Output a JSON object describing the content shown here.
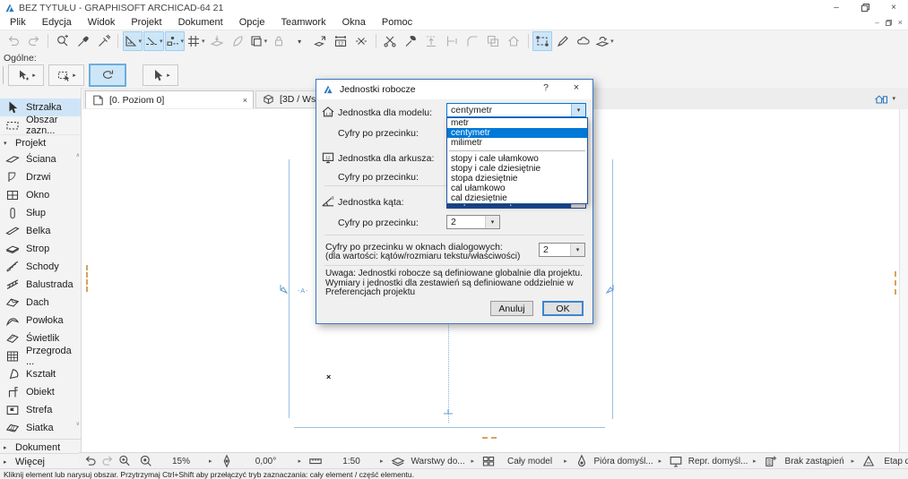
{
  "window": {
    "title": "BEZ TYTUŁU - GRAPHISOFT ARCHICAD-64 21",
    "controls": {
      "minimize": "–",
      "restore": "restore",
      "close": "×"
    }
  },
  "menu": {
    "items": [
      "Plik",
      "Edycja",
      "Widok",
      "Projekt",
      "Dokument",
      "Opcje",
      "Teamwork",
      "Okna",
      "Pomoc"
    ]
  },
  "toolbar": {
    "buttons": [
      {
        "icon": "undo",
        "state": "disabled"
      },
      {
        "icon": "redo",
        "state": "disabled"
      },
      {
        "sep": true
      },
      {
        "icon": "zoom-select"
      },
      {
        "icon": "eyedropper"
      },
      {
        "icon": "syringe"
      },
      {
        "sep": true
      },
      {
        "icon": "guide-setsquare",
        "state": "active",
        "dd": true
      },
      {
        "icon": "snap-guides",
        "state": "active",
        "dd": true
      },
      {
        "icon": "snap-points",
        "state": "active",
        "dd": true
      },
      {
        "icon": "grid-snap",
        "dd": true
      },
      {
        "icon": "gravity",
        "state": "disabled"
      },
      {
        "icon": "plane",
        "state": "disabled"
      },
      {
        "icon": "frame",
        "dd": true
      },
      {
        "icon": "lock",
        "state": "disabled"
      },
      {
        "icon": "chevron-down"
      },
      {
        "icon": "move"
      },
      {
        "icon": "dimension-12"
      },
      {
        "icon": "stretch"
      },
      {
        "sep": true
      },
      {
        "icon": "split"
      },
      {
        "icon": "adjust"
      },
      {
        "icon": "elevate",
        "state": "disabled"
      },
      {
        "icon": "trim",
        "state": "disabled"
      },
      {
        "icon": "fillet",
        "state": "disabled"
      },
      {
        "icon": "intersect",
        "state": "disabled"
      },
      {
        "icon": "home",
        "state": "disabled"
      },
      {
        "sep": true
      },
      {
        "icon": "marquee-transform",
        "state": "active"
      },
      {
        "icon": "edit-pencil"
      },
      {
        "icon": "revision-cloud"
      },
      {
        "icon": "visual-compare",
        "dd": true
      }
    ]
  },
  "general_palette": {
    "label": "Ogólne:",
    "buttons": [
      {
        "icon": "select-move",
        "fly": true
      },
      {
        "icon": "marquee-select",
        "fly": true
      },
      {
        "icon": "rotate-orbit",
        "state": "active"
      },
      {
        "icon": "arrow-tool",
        "fly": true,
        "gap": true
      }
    ]
  },
  "toolbox": {
    "items": [
      {
        "label": "Strzałka",
        "icon": "arrow-cursor",
        "selected": true
      },
      {
        "label": "Obszar zazn...",
        "icon": "marquee"
      },
      {
        "label": "Projekt",
        "group": true,
        "expanded": true
      },
      {
        "label": "Ściana",
        "icon": "wall"
      },
      {
        "label": "Drzwi",
        "icon": "door"
      },
      {
        "label": "Okno",
        "icon": "window"
      },
      {
        "label": "Słup",
        "icon": "column"
      },
      {
        "label": "Belka",
        "icon": "beam"
      },
      {
        "label": "Strop",
        "icon": "slab"
      },
      {
        "label": "Schody",
        "icon": "stairs"
      },
      {
        "label": "Balustrada",
        "icon": "railing"
      },
      {
        "label": "Dach",
        "icon": "roof"
      },
      {
        "label": "Powłoka",
        "icon": "shell"
      },
      {
        "label": "Świetlik",
        "icon": "skylight"
      },
      {
        "label": "Przegroda ...",
        "icon": "curtain-wall"
      },
      {
        "label": "Kształt",
        "icon": "morph"
      },
      {
        "label": "Obiekt",
        "icon": "object-chair"
      },
      {
        "label": "Strefa",
        "icon": "zone"
      },
      {
        "label": "Siatka",
        "icon": "mesh"
      },
      {
        "label": "Dokument",
        "group": true,
        "pinned": true
      },
      {
        "label": "Więcej",
        "group": true,
        "pinned": true
      }
    ]
  },
  "tabs": {
    "items": [
      {
        "label": "[0. Poziom 0]",
        "icon": "floorplan",
        "active": true,
        "close": "×"
      },
      {
        "label": "[3D / Wszystk",
        "icon": "cube",
        "active": false
      }
    ],
    "right_icon": "project-home"
  },
  "dialog": {
    "title": "Jednostki robocze",
    "help_label": "?",
    "close_label": "×",
    "fields": {
      "model": {
        "label": "Jednostka dla modelu:",
        "value": "centymetr"
      },
      "model_digits": {
        "label": "Cyfry po przecinku:"
      },
      "layout": {
        "label": "Jednostka dla arkusza:"
      },
      "layout_digits": {
        "label": "Cyfry po przecinku:"
      },
      "angle": {
        "label": "Jednostka kąta:",
        "value": "stopnie dziesiętnie"
      },
      "angle_digits": {
        "label": "Cyfry po przecinku:",
        "value": "2"
      }
    },
    "dropdown": {
      "metric_options": [
        "metr",
        "centymetr",
        "milimetr"
      ],
      "imperial_options": [
        "stopy i cale ułamkowo",
        "stopy i cale dziesiętnie",
        "stopa dziesiętnie",
        "cal ułamkowo",
        "cal dziesiętnie"
      ],
      "selected": "centymetr"
    },
    "dialog_digits": {
      "label": "Cyfry po przecinku w oknach dialogowych:",
      "sublabel": "(dla wartości: kątów/rozmiaru tekstu/właściwości)",
      "value": "2"
    },
    "note": "Uwaga: Jednostki robocze są definiowane globalnie dla projektu. Wymiary i jednostki dla zestawień są definiowane oddzielnie w Preferencjach projektu",
    "buttons": {
      "cancel": "Anuluj",
      "ok": "OK"
    }
  },
  "quickbar": {
    "groups": [
      {
        "name": "navigation",
        "buttons": [
          {
            "icon": "nav-back"
          },
          {
            "icon": "nav-forward",
            "state": "disabled"
          },
          {
            "icon": "zoom-in"
          }
        ]
      },
      {
        "name": "zoom",
        "buttons": [
          {
            "icon": "zoom-fit"
          }
        ],
        "value": "15%",
        "arrow": true,
        "vw": 56
      },
      {
        "name": "orientation",
        "buttons": [
          {
            "icon": "orientation"
          }
        ],
        "value": "0,00°",
        "arrow": true,
        "vw": 66
      },
      {
        "name": "scale",
        "buttons": [
          {
            "icon": "scale-ruler"
          }
        ],
        "value": "1:50",
        "arrow": true,
        "vw": 58
      },
      {
        "name": "layers",
        "buttons": [
          {
            "icon": "layers"
          }
        ],
        "value": "Warstwy do...",
        "arrow": true,
        "vw": 68
      },
      {
        "name": "model-filter",
        "buttons": [
          {
            "icon": "model-filter"
          }
        ],
        "value": "Cały model",
        "arrow": true,
        "vw": 70
      },
      {
        "name": "pens",
        "buttons": [
          {
            "icon": "pen-set"
          }
        ],
        "value": "Pióra domyśl...",
        "arrow": true,
        "vw": 72
      },
      {
        "name": "representation",
        "buttons": [
          {
            "icon": "representation"
          }
        ],
        "value": "Repr. domyśl...",
        "arrow": true,
        "vw": 72
      },
      {
        "name": "overrides",
        "buttons": [
          {
            "icon": "overrides"
          }
        ],
        "value": "Brak zastąpień",
        "arrow": true,
        "vw": 76
      },
      {
        "name": "phase",
        "buttons": [
          {
            "icon": "phase"
          }
        ],
        "value": "Etap domyślny",
        "arrow": true,
        "vw": 78
      }
    ]
  },
  "canvas": {
    "elevation_marker_left": "-A-",
    "elevation_marker_right": "-A-",
    "origin_marker": "×"
  },
  "statusbar": {
    "text": "Kliknij element lub narysuj obszar. Przytrzymaj Ctrl+Shift aby przełączyć tryb zaznaczania: cały element / część elementu."
  },
  "colors": {
    "accent": "#0078d7",
    "toolbar_highlight": "#cde6f7",
    "selection_row": "#cfe5f7",
    "section_line": "#9cc0e2",
    "marker_orange": "#dca05f",
    "dialog_border": "#3c78c8"
  }
}
